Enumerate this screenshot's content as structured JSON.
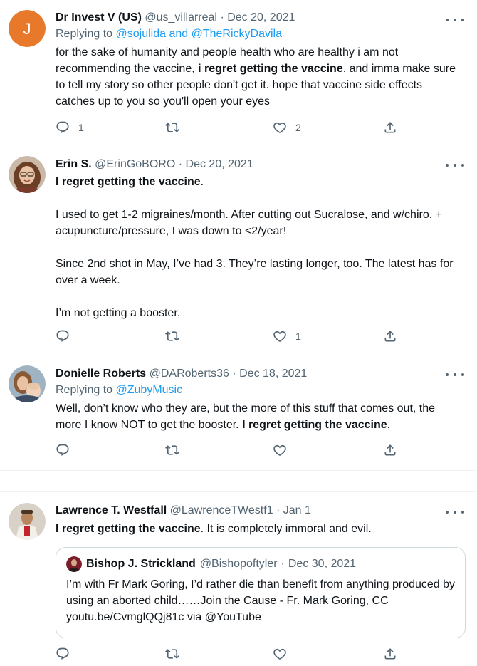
{
  "tweets": [
    {
      "name": "Dr Invest V (US)",
      "handle": "@us_villarreal",
      "dot": "·",
      "date": "Dec 20, 2021",
      "avatar_letter": "J",
      "avatar_color": "#e8792b",
      "replying_prefix": "Replying to",
      "replying_handles": "@sojulida and @TheRickyDavila",
      "text_a": "for the sake of humanity and people health who are healthy i am not recommending the vaccine, ",
      "text_bold": "i regret getting the vaccine",
      "text_b": ". and imma make sure to tell my story so other people don't get it. hope that vaccine side effects catches up to you so you'll open your eyes",
      "reply_count": "1",
      "like_count": "2"
    },
    {
      "name": "Erin S.",
      "handle": "@ErinGoBORO",
      "dot": "·",
      "date": "Dec 20, 2021",
      "text_bold": "I regret getting the vaccine",
      "text_after_bold": ".",
      "paragraph_2": "I used to get 1-2 migraines/month. After cutting out Sucralose, and w/chiro. + acupuncture/pressure, I was down to <2/year!",
      "paragraph_3": "Since 2nd shot in May, I’ve had 3. They’re lasting longer, too. The latest has for over a week.",
      "paragraph_4": "I’m not getting a booster.",
      "like_count": "1"
    },
    {
      "name": "Donielle Roberts",
      "handle": "@DARoberts36",
      "dot": "·",
      "date": "Dec 18, 2021",
      "replying_prefix": "Replying to",
      "replying_handles": "@ZubyMusic",
      "text_a": "Well, don’t know who they are, but the more of this stuff that comes out, the more I know NOT to get the booster. ",
      "text_bold": "I regret getting the vaccine",
      "text_b": "."
    },
    {
      "name": "Lawrence T. Westfall",
      "handle": "@LawrenceTWestf1",
      "dot": "·",
      "date": "Jan 1",
      "text_bold": "I regret getting the vaccine",
      "text_b": ". It is completely immoral and evil.",
      "quote": {
        "name": "Bishop J. Strickland",
        "handle": "@Bishopoftyler",
        "dot": "·",
        "date": "Dec 30, 2021",
        "text": "I’m with Fr Mark Goring, I’d rather die than benefit from anything produced by using an aborted child……Join the Cause - Fr. Mark Goring, CC youtu.be/CvmglQQj81c via @YouTube"
      }
    }
  ],
  "icons": {
    "reply": "reply-icon",
    "retweet": "retweet-icon",
    "like": "like-icon",
    "share": "share-icon",
    "more": "more-icon"
  },
  "colors": {
    "link": "#1d9bf0",
    "secondary_text": "#536471",
    "divider": "#eff3f4"
  }
}
